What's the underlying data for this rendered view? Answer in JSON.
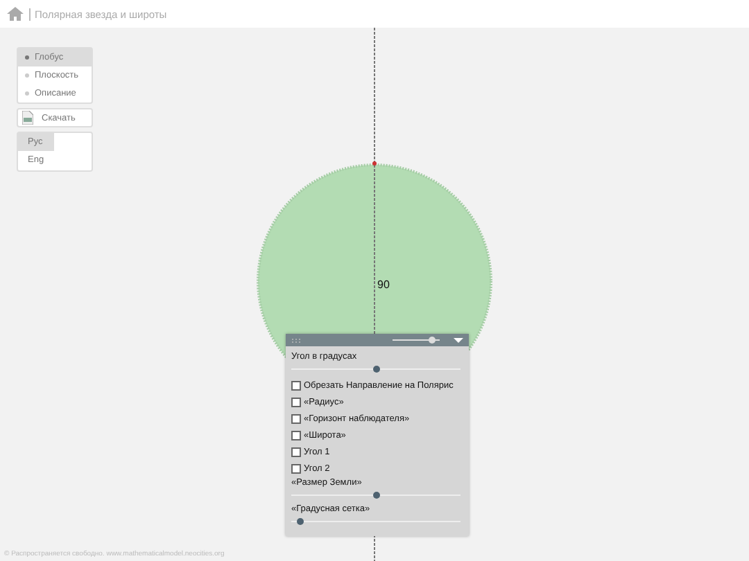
{
  "header": {
    "title": "Полярная звезда и широты"
  },
  "view_menu": [
    {
      "label": "Глобус",
      "selected": true
    },
    {
      "label": "Плоскость",
      "selected": false
    },
    {
      "label": "Описание",
      "selected": false
    }
  ],
  "download": {
    "label": "Скачать"
  },
  "languages": [
    {
      "label": "Рус",
      "selected": true
    },
    {
      "label": "Eng",
      "selected": false
    }
  ],
  "canvas": {
    "angle_label": "90"
  },
  "panel": {
    "header_slider": {
      "level": 0.85
    },
    "controls": [
      {
        "kind": "slider",
        "label": "Угол в градусах",
        "level": 0.5
      },
      {
        "kind": "checkbox",
        "label": "Обрезать Направление на Полярис",
        "checked": false
      },
      {
        "kind": "checkbox",
        "label": "«Радиус»",
        "checked": false
      },
      {
        "kind": "checkbox",
        "label": "«Горизонт наблюдателя»",
        "checked": false
      },
      {
        "kind": "checkbox",
        "label": "«Широта»",
        "checked": false
      },
      {
        "kind": "checkbox",
        "label": "Угол 1",
        "checked": false
      },
      {
        "kind": "checkbox",
        "label": "Угол 2",
        "checked": false
      },
      {
        "kind": "slider",
        "label": "«Размер Земли»",
        "level": 0.5
      },
      {
        "kind": "slider",
        "label": "«Градусная сетка»",
        "level": 0.05
      }
    ]
  },
  "footer": {
    "text": "© Распространяется свободно. www.mathematicalmodel.neocities.org"
  }
}
